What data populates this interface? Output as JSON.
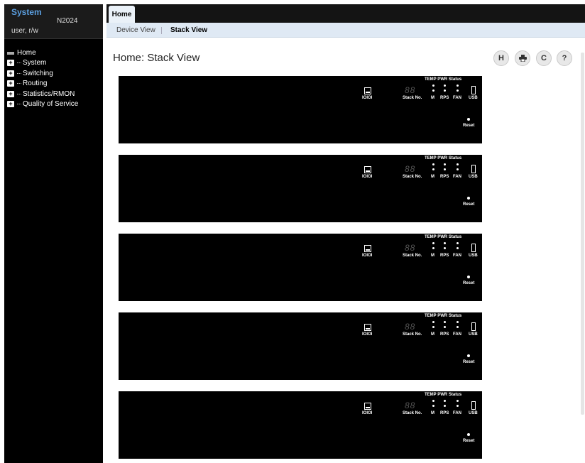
{
  "sidebar": {
    "title": "System",
    "model": "N2024",
    "user": "user, r/w",
    "items": [
      {
        "label": "Home",
        "icon": "home-icon"
      },
      {
        "label": "System",
        "icon": "expand-icon"
      },
      {
        "label": "Switching",
        "icon": "expand-icon"
      },
      {
        "label": "Routing",
        "icon": "expand-icon"
      },
      {
        "label": "Statistics/RMON",
        "icon": "expand-icon"
      },
      {
        "label": "Quality of Service",
        "icon": "expand-icon"
      }
    ]
  },
  "tabs": {
    "home": "Home",
    "device_view": "Device View",
    "stack_view": "Stack View"
  },
  "page": {
    "title": "Home: Stack View"
  },
  "toolbar": {
    "save_icon": "H",
    "print_icon": "printer-icon",
    "refresh_icon": "C",
    "help_icon": "?"
  },
  "unit_labels": {
    "status_header": "TEMP PWR Status",
    "console": "IOIOI",
    "stack_digits": "88",
    "stack_label": "Stack No.",
    "m": "M",
    "rps": "RPS",
    "fan": "FAN",
    "usb": "USB",
    "reset": "Reset"
  },
  "unit_count": 5,
  "colors": {
    "sidebar_bg": "#000000",
    "tabbar_bg": "#141414",
    "subtab_bg": "#dfe9f4",
    "system_title": "#5b9fe0",
    "unit_bg": "#000000"
  }
}
